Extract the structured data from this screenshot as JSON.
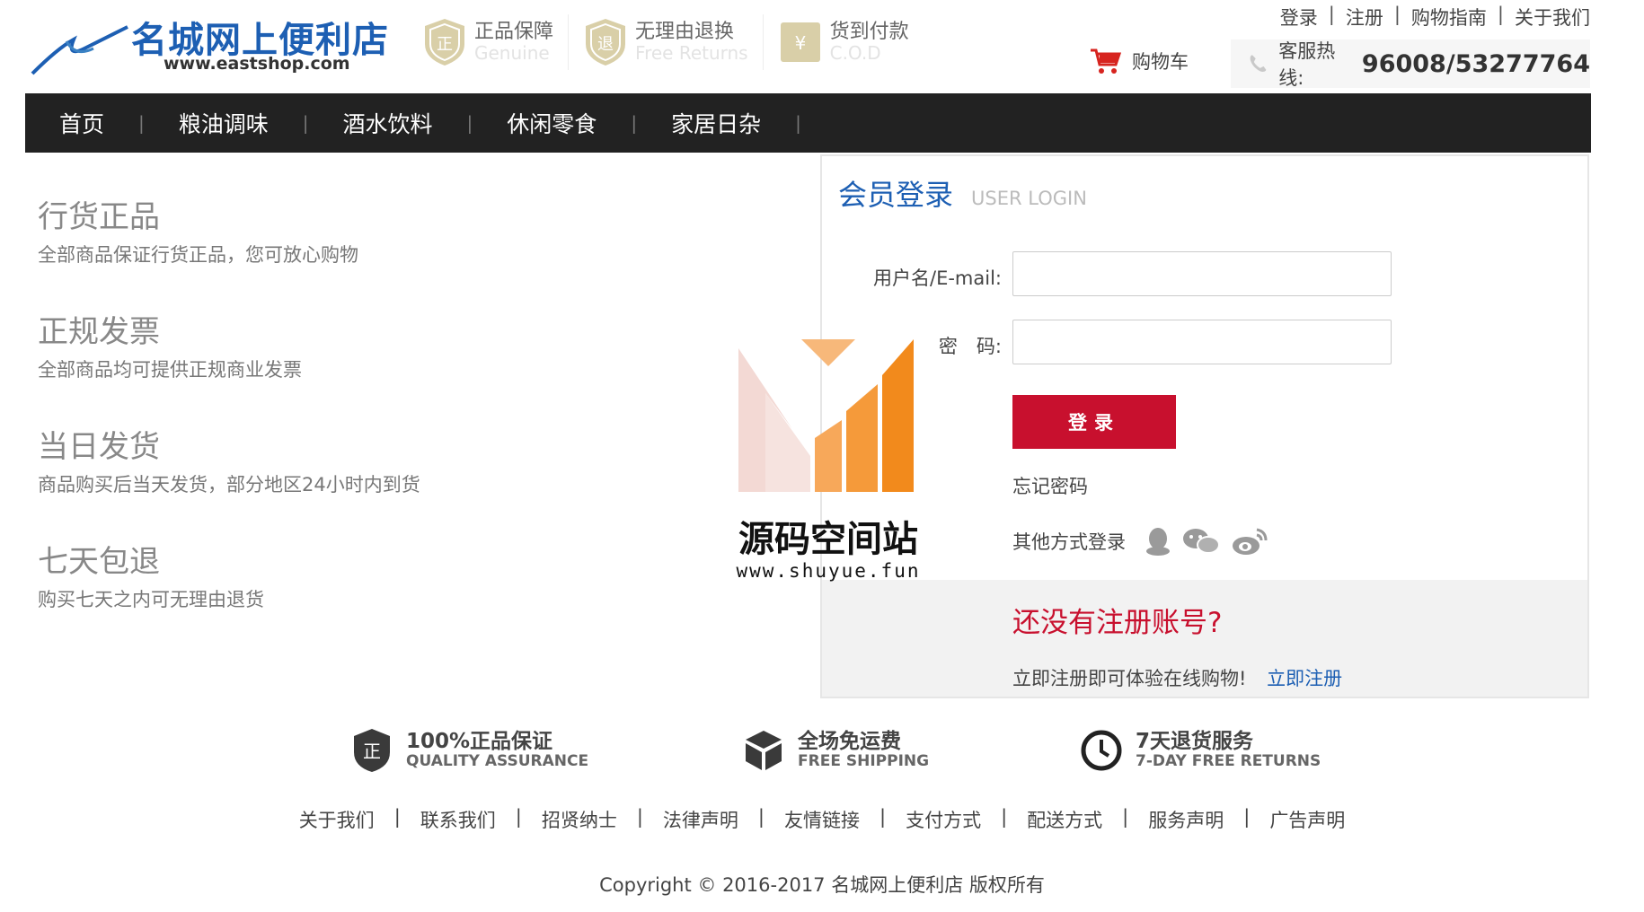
{
  "header": {
    "logo_title": "名城网上便利店",
    "logo_url": "www.eastshop.com",
    "badges": [
      {
        "cn": "正品保障",
        "en": "Genuine",
        "icon": "shield-zheng-icon"
      },
      {
        "cn": "无理由退换",
        "en": "Free Returns",
        "icon": "shield-return-icon"
      },
      {
        "cn": "货到付款",
        "en": "C.O.D",
        "icon": "cod-icon"
      }
    ],
    "top_links": [
      "登录",
      "注册",
      "购物指南",
      "关于我们"
    ],
    "cart_label": "购物车",
    "hotline_label": "客服热线:",
    "hotline_number": "96008/53277764"
  },
  "nav": {
    "items": [
      "首页",
      "粮油调味",
      "酒水饮料",
      "休闲零食",
      "家居日杂"
    ]
  },
  "features": [
    {
      "title": "行货正品",
      "desc": "全部商品保证行货正品，您可放心购物"
    },
    {
      "title": "正规发票",
      "desc": "全部商品均可提供正规商业发票"
    },
    {
      "title": "当日发货",
      "desc": "商品购买后当天发货，部分地区24小时内到货"
    },
    {
      "title": "七天包退",
      "desc": "购买七天之内可无理由退货"
    }
  ],
  "login": {
    "title": "会员登录",
    "subtitle": "USER LOGIN",
    "username_label": "用户名/E-mail:",
    "username_value": "",
    "password_label": "密　码:",
    "password_value": "",
    "submit_label": "登录",
    "forgot_label": "忘记密码",
    "other_login_label": "其他方式登录",
    "social_icons": [
      "qq-icon",
      "wechat-icon",
      "weibo-icon"
    ],
    "register_title": "还没有注册账号?",
    "register_text": "立即注册即可体验在线购物!",
    "register_link": "立即注册"
  },
  "watermark": {
    "text": "源码空间站",
    "url": "www.shuyue.fun"
  },
  "services": [
    {
      "cn": "100%正品保证",
      "en": "QUALITY ASSURANCE",
      "icon": "quality-shield-icon"
    },
    {
      "cn": "全场免运费",
      "en": "FREE SHIPPING",
      "icon": "box-icon"
    },
    {
      "cn": "7天退货服务",
      "en": "7-DAY FREE RETURNS",
      "icon": "clock-icon"
    }
  ],
  "footer": {
    "links": [
      "关于我们",
      "联系我们",
      "招贤纳士",
      "法律声明",
      "友情链接",
      "支付方式",
      "配送方式",
      "服务声明",
      "广告声明"
    ],
    "copyright": "Copyright © 2016-2017 名城网上便利店 版权所有"
  },
  "colors": {
    "brand_blue": "#1d5fb3",
    "brand_red": "#c8102e",
    "nav_bg": "#222222"
  }
}
